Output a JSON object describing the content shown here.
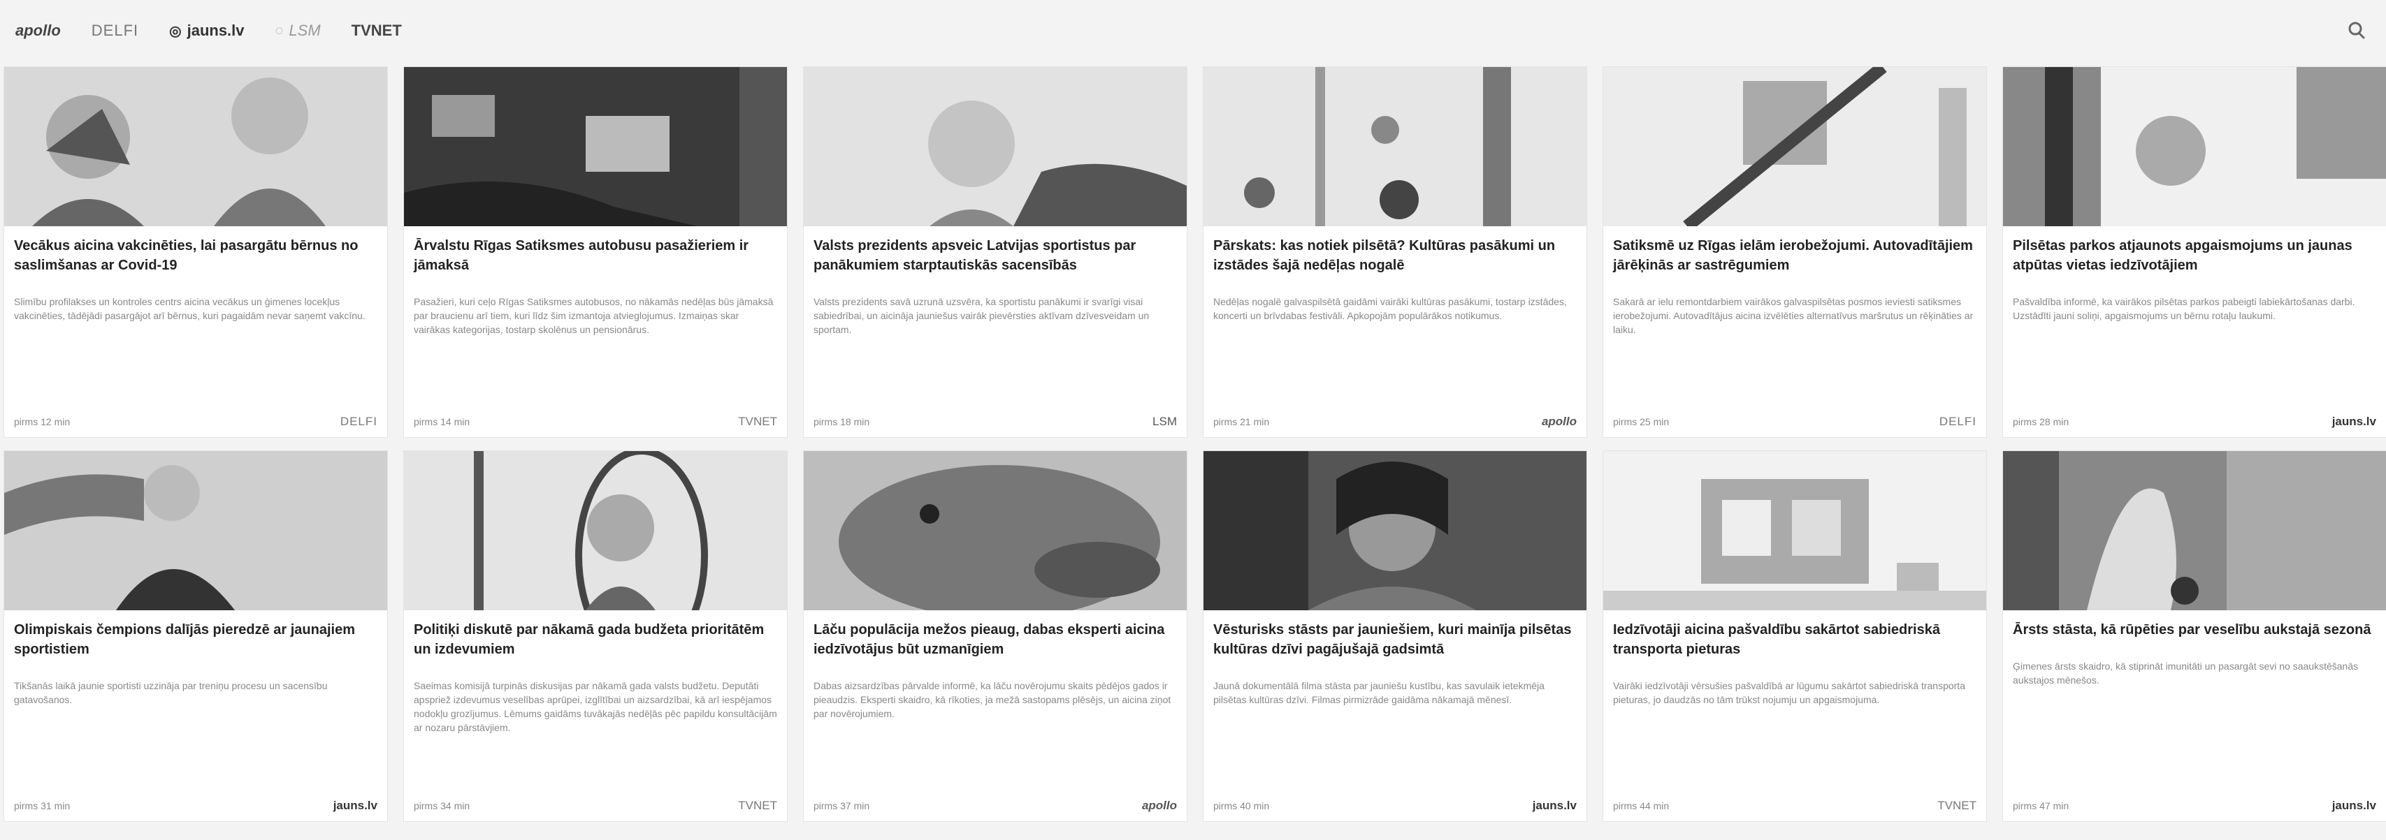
{
  "header": {
    "sources": [
      {
        "label": "apollo"
      },
      {
        "label": "DELFI"
      },
      {
        "label": "jauns.lv"
      },
      {
        "label": "LSM"
      },
      {
        "label": "TVNET"
      }
    ]
  },
  "articles": [
    {
      "title": "Vecākus aicina vakcinēties, lai pasargātu bērnus no saslimšanas ar Covid-19",
      "excerpt": "Slimību profilakses un kontroles centrs aicina vecākus un ģimenes locekļus vakcinēties, tādējādi pasargājot arī bērnus, kuri pagaidām nevar saņemt vakcīnu.",
      "time": "pirms 12 min",
      "source": "DELFI"
    },
    {
      "title": "Ārvalstu Rīgas Satiksmes autobusu pasažieriem ir jāmaksā",
      "excerpt": "Pasažieri, kuri ceļo Rīgas Satiksmes autobusos, no nākamās nedēļas būs jāmaksā par braucienu arī tiem, kuri līdz šim izmantoja atvieglojumus. Izmaiņas skar vairākas kategorijas, tostarp skolēnus un pensionārus.",
      "time": "pirms 14 min",
      "source": "TVNET"
    },
    {
      "title": "Valsts prezidents apsveic Latvijas sportistus par panākumiem starptautiskās sacensībās",
      "excerpt": "Valsts prezidents savā uzrunā uzsvēra, ka sportistu panākumi ir svarīgi visai sabiedrībai, un aicināja jauniešus vairāk pievērsties aktīvam dzīvesveidam un sportam.",
      "time": "pirms 18 min",
      "source": "LSM"
    },
    {
      "title": "Pārskats: kas notiek pilsētā? Kultūras pasākumi un izstādes šajā nedēļas nogalē",
      "excerpt": "Nedēļas nogalē galvaspilsētā gaidāmi vairāki kultūras pasākumi, tostarp izstādes, koncerti un brīvdabas festivāli. Apkopojām populārākos notikumus.",
      "time": "pirms 21 min",
      "source": "apollo"
    },
    {
      "title": "Satiksmē uz Rīgas ielām ierobežojumi. Autovadītājiem jārēķinās ar sastrēgumiem",
      "excerpt": "Sakarā ar ielu remontdarbiem vairākos galvaspilsētas posmos ieviesti satiksmes ierobežojumi. Autovadītājus aicina izvēlēties alternatīvus maršrutus un rēķināties ar laiku.",
      "time": "pirms 25 min",
      "source": "DELFI"
    },
    {
      "title": "Pilsētas parkos atjaunots apgaismojums un jaunas atpūtas vietas iedzīvotājiem",
      "excerpt": "Pašvaldība informē, ka vairākos pilsētas parkos pabeigti labiekārtošanas darbi. Uzstādīti jauni soliņi, apgaismojums un bērnu rotaļu laukumi.",
      "time": "pirms 28 min",
      "source": "jauns.lv"
    },
    {
      "title": "Olimpiskais čempions dalījās pieredzē ar jaunajiem sportistiem",
      "excerpt": "Tikšanās laikā jaunie sportisti uzzināja par treniņu procesu un sacensību gatavošanos.",
      "time": "pirms 31 min",
      "source": "jauns.lv"
    },
    {
      "title": "Politiķi diskutē par nākamā gada budžeta prioritātēm un izdevumiem",
      "excerpt": "Saeimas komisijā turpinās diskusijas par nākamā gada valsts budžetu. Deputāti apspriež izdevumus veselības aprūpei, izglītībai un aizsardzībai, kā arī iespējamos nodokļu grozījumus. Lēmums gaidāms tuvākajās nedēļās pēc papildu konsultācijām ar nozaru pārstāvjiem.",
      "time": "pirms 34 min",
      "source": "TVNET"
    },
    {
      "title": "Lāču populācija mežos pieaug, dabas eksperti aicina iedzīvotājus būt uzmanīgiem",
      "excerpt": "Dabas aizsardzības pārvalde informē, ka lāču novērojumu skaits pēdējos gados ir pieaudzis. Eksperti skaidro, kā rīkoties, ja mežā sastopams plēsējs, un aicina ziņot par novērojumiem.",
      "time": "pirms 37 min",
      "source": "apollo"
    },
    {
      "title": "Vēsturisks stāsts par jauniešiem, kuri mainīja pilsētas kultūras dzīvi pagājušajā gadsimtā",
      "excerpt": "Jaunā dokumentālā filma stāsta par jauniešu kustību, kas savulaik ietekmēja pilsētas kultūras dzīvi. Filmas pirmizrāde gaidāma nākamajā mēnesī.",
      "time": "pirms 40 min",
      "source": "jauns.lv"
    },
    {
      "title": "Iedzīvotāji aicina pašvaldību sakārtot sabiedriskā transporta pieturas",
      "excerpt": "Vairāki iedzīvotāji vērsušies pašvaldībā ar lūgumu sakārtot sabiedriskā transporta pieturas, jo daudzās no tām trūkst nojumju un apgaismojuma.",
      "time": "pirms 44 min",
      "source": "TVNET"
    },
    {
      "title": "Ārsts stāsta, kā rūpēties par veselību aukstajā sezonā",
      "excerpt": "Ģimenes ārsts skaidro, kā stiprināt imunitāti un pasargāt sevi no saaukstēšanās aukstajos mēnešos.",
      "time": "pirms 47 min",
      "source": "jauns.lv"
    }
  ]
}
